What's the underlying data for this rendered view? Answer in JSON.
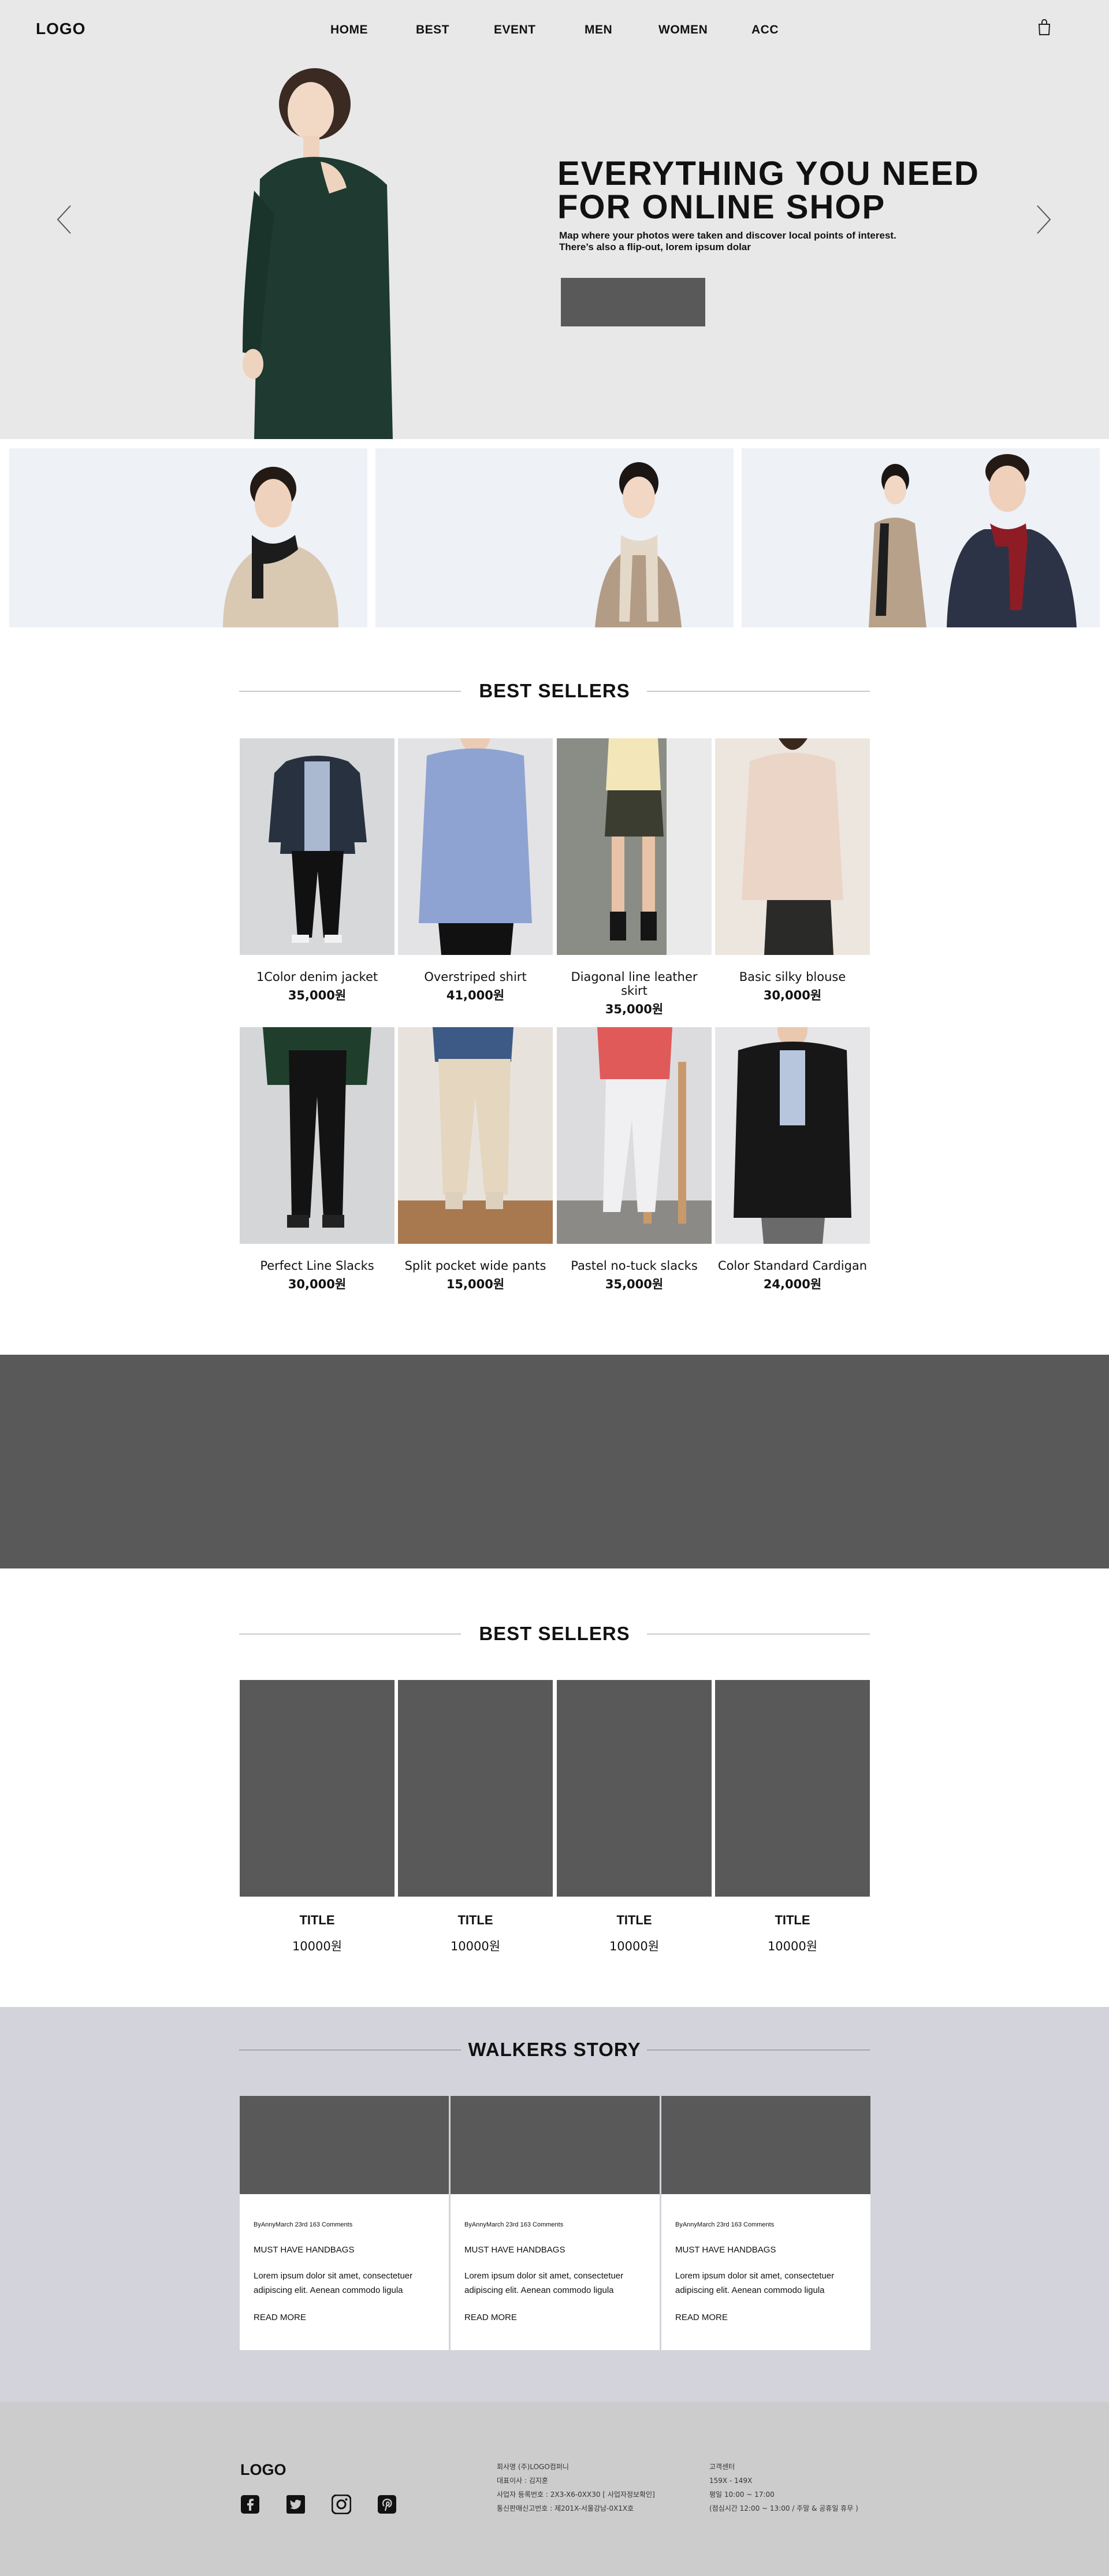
{
  "header": {
    "logo": "LOGO",
    "nav": [
      "HOME",
      "BEST",
      "EVENT",
      "MEN",
      "WOMEN",
      "ACC"
    ]
  },
  "hero": {
    "title_lines": [
      "EVERYTHING YOU NEED",
      "FOR ONLINE SHOP"
    ],
    "subtitle_lines": [
      "Map where your photos were taken and discover local points of interest.",
      "There’s also a flip-out, lorem ipsum dolar"
    ]
  },
  "best_sellers": {
    "title": "BEST SELLERS",
    "products": [
      {
        "name": "1Color denim jacket",
        "price": "35,000원"
      },
      {
        "name": "Overstriped shirt",
        "price": "41,000원"
      },
      {
        "name": "Diagonal line leather skirt",
        "price": "35,000원"
      },
      {
        "name": "Basic silky blouse",
        "price": "30,000원"
      },
      {
        "name": "Perfect Line Slacks",
        "price": "30,000원"
      },
      {
        "name": "Split pocket wide pants",
        "price": "15,000원"
      },
      {
        "name": "Pastel no-tuck slacks",
        "price": "35,000원"
      },
      {
        "name": "Color Standard Cardigan",
        "price": "24,000원"
      }
    ]
  },
  "best_sellers_2": {
    "title": "BEST SELLERS",
    "items": [
      {
        "title": "TITLE",
        "price": "10000원"
      },
      {
        "title": "TITLE",
        "price": "10000원"
      },
      {
        "title": "TITLE",
        "price": "10000원"
      },
      {
        "title": "TITLE",
        "price": "10000원"
      }
    ]
  },
  "story": {
    "title": "WALKERS STORY",
    "posts": [
      {
        "meta": "ByAnnyMarch 23rd 163 Comments",
        "heading": "MUST HAVE HANDBAGS",
        "body_lines": [
          "Lorem ipsum dolor sit amet, consectetuer",
          "adipiscing elit. Aenean commodo ligula"
        ],
        "more": "READ MORE"
      },
      {
        "meta": "ByAnnyMarch 23rd 163 Comments",
        "heading": "MUST HAVE HANDBAGS",
        "body_lines": [
          "Lorem ipsum dolor sit amet, consectetuer",
          "adipiscing elit. Aenean commodo ligula"
        ],
        "more": "READ MORE"
      },
      {
        "meta": "ByAnnyMarch 23rd 163 Comments",
        "heading": "MUST HAVE HANDBAGS",
        "body_lines": [
          "Lorem ipsum dolor sit amet, consectetuer",
          "adipiscing elit. Aenean commodo ligula"
        ],
        "more": "READ MORE"
      }
    ]
  },
  "footer": {
    "logo": "LOGO",
    "company_lines": [
      "회사명 (주)LOGO컴퍼니",
      "대표이사 : 김지훈",
      "사업자 등록번호 : 2X3-X6-0XX30 [ 사업자정보확인]",
      "통신판매신고번호 : 제201X-서울강남-0X1X호"
    ],
    "cs_lines": [
      "고객센터",
      "159X - 149X",
      "평일 10:00 ~ 17:00",
      "(점심시간 12:00 ~ 13:00 / 주말 & 공휴일 휴무 )"
    ],
    "social_icons": [
      "facebook-icon",
      "twitter-icon",
      "instagram-icon",
      "pinterest-icon"
    ]
  },
  "colors": {
    "hero_bg": "#e8e8e8",
    "placeholder": "#595959",
    "story_bg": "#d3d3db",
    "footer_bg": "#cccccc"
  }
}
